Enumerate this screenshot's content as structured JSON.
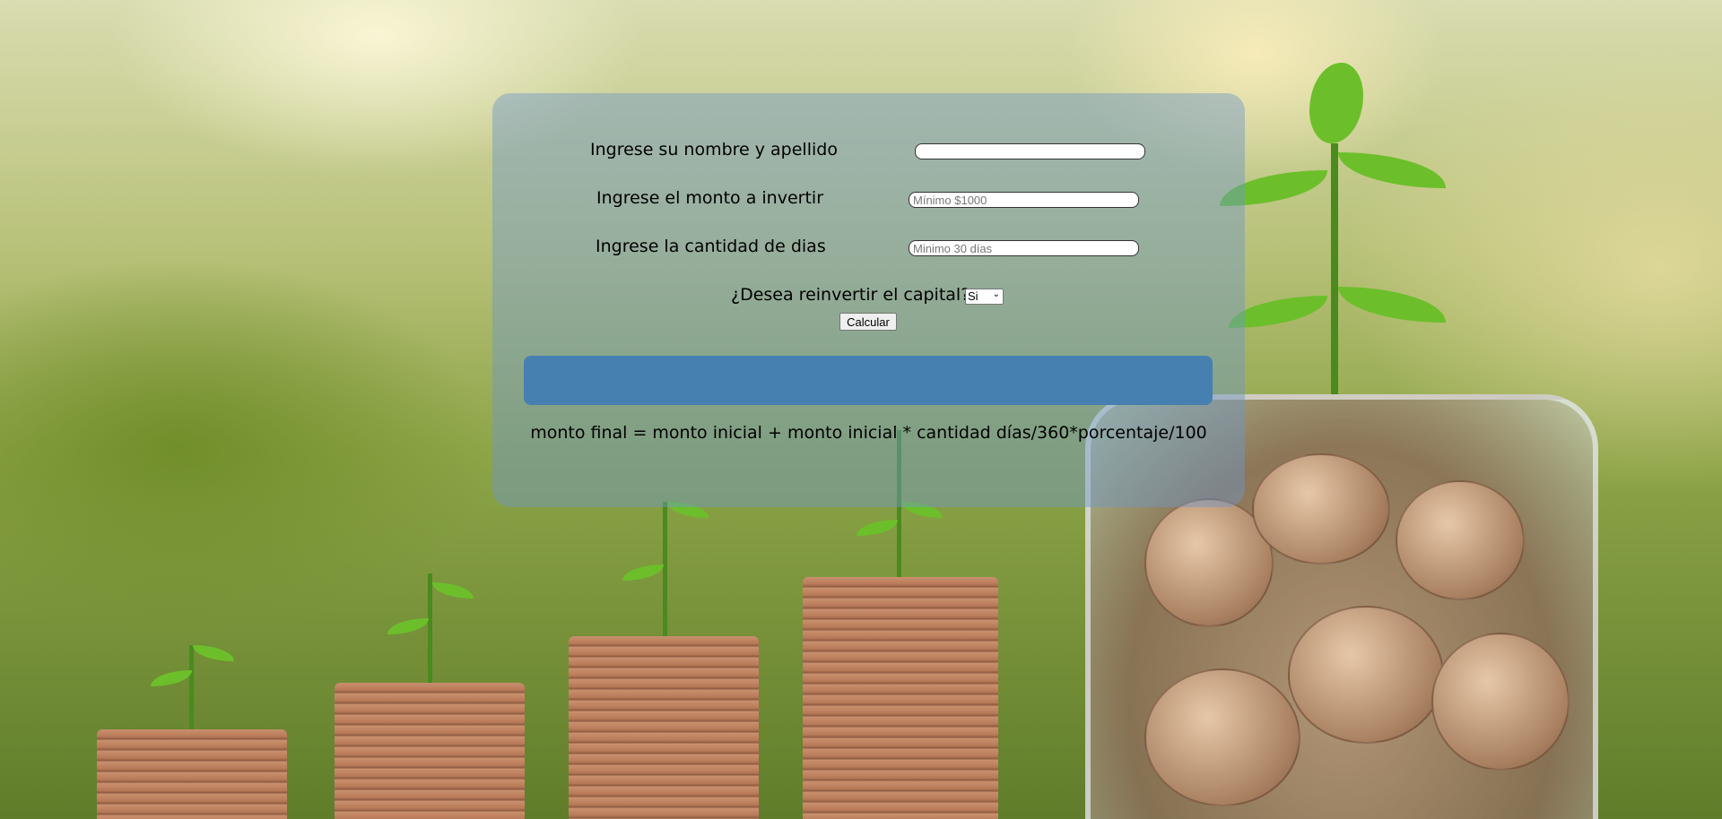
{
  "form": {
    "name_label": "Ingrese su nombre y apellido",
    "name_value": "",
    "amount_label": "Ingrese el monto a invertir",
    "amount_placeholder": "Mínimo $1000",
    "days_label": "Ingrese la cantidad de dias",
    "days_placeholder": "Minimo 30 días",
    "reinvest_question": "¿Desea reinvertir el capital?",
    "reinvest_selected": "Si",
    "calculate_label": "Calcular",
    "result_text": "",
    "formula_text": "monto final = monto inicial + monto inicial * cantidad días/360*porcentaje/100"
  },
  "colors": {
    "panel": "#6e96c8",
    "result_box": "#4580b1"
  }
}
